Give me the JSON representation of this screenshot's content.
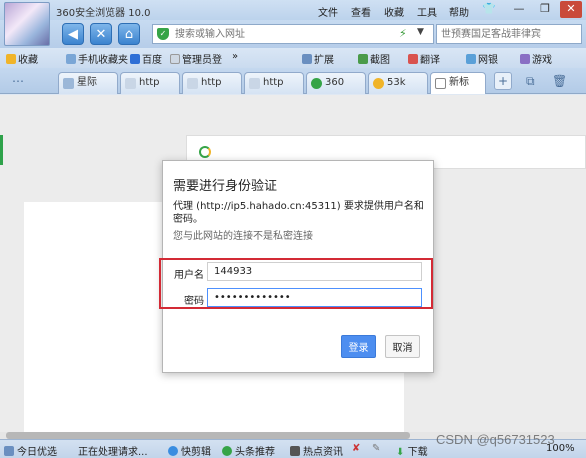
{
  "window": {
    "title": "360安全浏览器 10.0",
    "menu": [
      "文件",
      "查看",
      "收藏",
      "工具",
      "帮助"
    ],
    "controls": [
      "—",
      "❐",
      "✕"
    ]
  },
  "nav": {
    "back": "◀",
    "stop": "✕",
    "home": "⌂",
    "address_placeholder": "搜索或输入网址",
    "search_placeholder": "世预赛国足客战菲律宾"
  },
  "bookmarks": {
    "left": [
      "收藏",
      "手机收藏夹",
      "百度",
      "管理员登"
    ],
    "more": "»",
    "right": [
      "扩展",
      "截图",
      "翻译",
      "网银",
      "游戏"
    ]
  },
  "tabs": [
    "星际",
    "http",
    "http",
    "http",
    "360",
    "53k",
    "新标"
  ],
  "dialog": {
    "title": "需要进行身份验证",
    "message": "代理 (http://ip5.hahado.cn:45311) 要求提供用户名和密码。",
    "note": "您与此网站的连接不是私密连接",
    "username_label": "用户名",
    "username_value": "144933",
    "password_label": "密码",
    "password_value": "•••••••••••••",
    "login_label": "登录",
    "cancel_label": "取消"
  },
  "status": {
    "items": [
      "今日优选",
      "正在处理请求...",
      "快剪辑",
      "头条推荐",
      "热点资讯",
      "下载"
    ],
    "zoom": "100%"
  },
  "watermark": "CSDN @q56731523",
  "colors": {
    "accent": "#4d8ef0",
    "highlight_frame": "#d32a35",
    "shield": "#36a447"
  }
}
